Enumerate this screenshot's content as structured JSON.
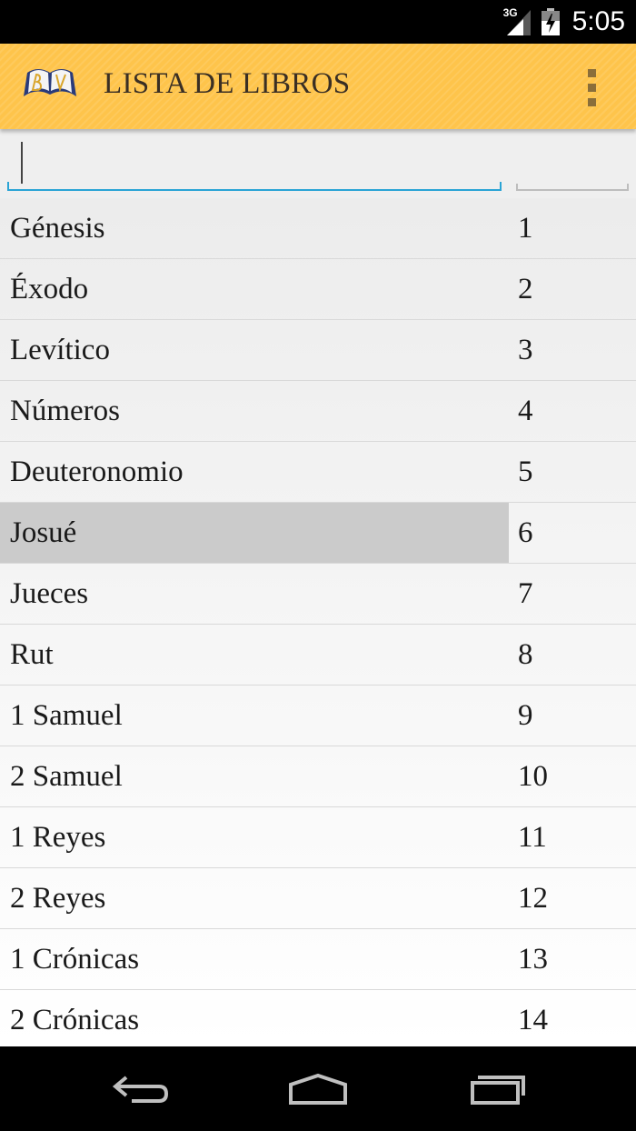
{
  "status_bar": {
    "network_type": "3G",
    "time": "5:05",
    "icons": [
      "signal-icon",
      "battery-charging-icon"
    ]
  },
  "action_bar": {
    "title": "LISTA DE LIBROS",
    "logo_icon": "open-bible-logo-icon",
    "menu_icon": "overflow-menu-icon",
    "colors": {
      "background": "#fec44b",
      "title": "#3a2f24"
    }
  },
  "search": {
    "value": "",
    "placeholder": "",
    "accent_color": "#2aa4d5"
  },
  "books": [
    {
      "name": "Génesis",
      "number": "1"
    },
    {
      "name": "Éxodo",
      "number": "2"
    },
    {
      "name": "Levítico",
      "number": "3"
    },
    {
      "name": "Números",
      "number": "4"
    },
    {
      "name": "Deuteronomio",
      "number": "5"
    },
    {
      "name": "Josué",
      "number": "6",
      "selected": true
    },
    {
      "name": "Jueces",
      "number": "7"
    },
    {
      "name": "Rut",
      "number": "8"
    },
    {
      "name": "1 Samuel",
      "number": "9"
    },
    {
      "name": "2 Samuel",
      "number": "10"
    },
    {
      "name": "1 Reyes",
      "number": "11"
    },
    {
      "name": "2 Reyes",
      "number": "12"
    },
    {
      "name": "1 Crónicas",
      "number": "13"
    },
    {
      "name": "2 Crónicas",
      "number": "14"
    }
  ],
  "nav_bar": {
    "icons": [
      "back-icon",
      "home-icon",
      "recent-apps-icon"
    ]
  }
}
